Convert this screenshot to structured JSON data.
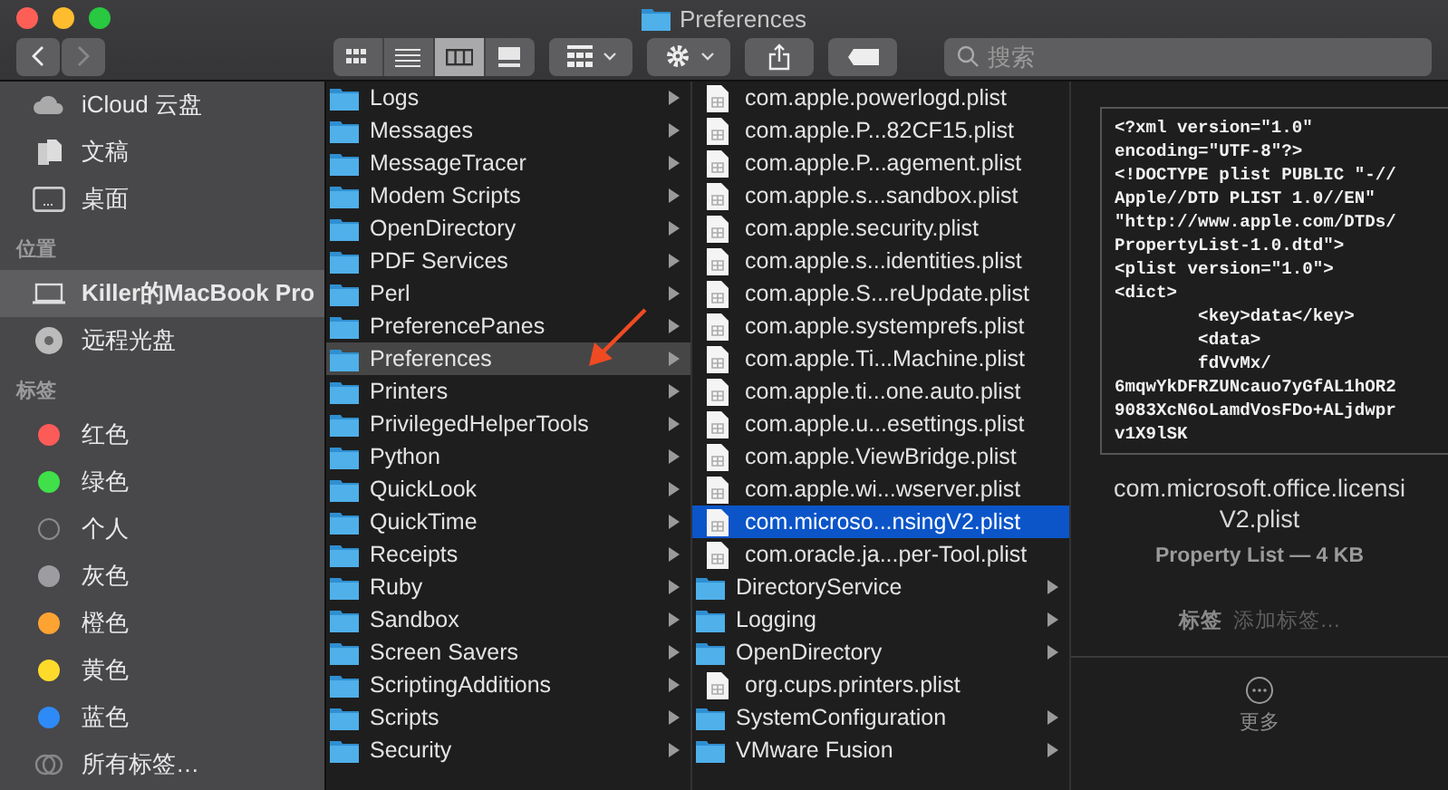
{
  "window": {
    "title": "Preferences"
  },
  "toolbar": {
    "back_disabled": false,
    "forward_disabled": true,
    "view_modes": [
      {
        "kind": "icons",
        "selected": false
      },
      {
        "kind": "list",
        "selected": false
      },
      {
        "kind": "columns",
        "selected": true
      },
      {
        "kind": "gallery",
        "selected": false
      }
    ],
    "search": {
      "placeholder": "搜索"
    }
  },
  "sidebar": [
    {
      "kind": "cloud",
      "label": "iCloud 云盘",
      "selected": false
    },
    {
      "kind": "docs",
      "label": "文稿",
      "selected": false
    },
    {
      "kind": "desktop",
      "label": "桌面",
      "selected": false
    },
    {
      "kind": "header",
      "label": "位置"
    },
    {
      "kind": "laptop",
      "label": "Killer的MacBook Pro",
      "selected": true
    },
    {
      "kind": "disc",
      "label": "远程光盘",
      "selected": false
    },
    {
      "kind": "header",
      "label": "标签"
    },
    {
      "kind": "tag",
      "label": "红色",
      "color": "#fc5b57"
    },
    {
      "kind": "tag",
      "label": "绿色",
      "color": "#3fe04a"
    },
    {
      "kind": "tag",
      "label": "个人"
    },
    {
      "kind": "tag",
      "label": "灰色",
      "color": "#9d9da1"
    },
    {
      "kind": "tag",
      "label": "橙色",
      "color": "#fda332"
    },
    {
      "kind": "tag",
      "label": "黄色",
      "color": "#fedb2b"
    },
    {
      "kind": "tag",
      "label": "蓝色",
      "color": "#2e8af7"
    },
    {
      "kind": "alltags",
      "label": "所有标签…",
      "selected": false
    }
  ],
  "columns": [
    [
      {
        "kind": "folder",
        "name": "Logs",
        "selected": false
      },
      {
        "kind": "folder",
        "name": "Messages",
        "selected": false
      },
      {
        "kind": "folder",
        "name": "MessageTracer",
        "selected": false
      },
      {
        "kind": "folder",
        "name": "Modem Scripts",
        "selected": false
      },
      {
        "kind": "folder",
        "name": "OpenDirectory",
        "selected": false
      },
      {
        "kind": "folder",
        "name": "PDF Services",
        "selected": false
      },
      {
        "kind": "folder",
        "name": "Perl",
        "selected": false
      },
      {
        "kind": "folder",
        "name": "PreferencePanes",
        "selected": false
      },
      {
        "kind": "folder",
        "name": "Preferences",
        "selected": true
      },
      {
        "kind": "folder",
        "name": "Printers",
        "selected": false
      },
      {
        "kind": "folder",
        "name": "PrivilegedHelperTools",
        "selected": false
      },
      {
        "kind": "folder",
        "name": "Python",
        "selected": false
      },
      {
        "kind": "folder",
        "name": "QuickLook",
        "selected": false
      },
      {
        "kind": "folder",
        "name": "QuickTime",
        "selected": false
      },
      {
        "kind": "folder",
        "name": "Receipts",
        "selected": false
      },
      {
        "kind": "folder",
        "name": "Ruby",
        "selected": false
      },
      {
        "kind": "folder",
        "name": "Sandbox",
        "selected": false
      },
      {
        "kind": "folder",
        "name": "Screen Savers",
        "selected": false
      },
      {
        "kind": "folder",
        "name": "ScriptingAdditions",
        "selected": false
      },
      {
        "kind": "folder",
        "name": "Scripts",
        "selected": false
      },
      {
        "kind": "folder",
        "name": "Security",
        "selected": false
      }
    ],
    [
      {
        "kind": "file",
        "name": "com.apple.powerlogd.plist",
        "selected": false
      },
      {
        "kind": "file",
        "name": "com.apple.P...82CF15.plist",
        "selected": false
      },
      {
        "kind": "file",
        "name": "com.apple.P...agement.plist",
        "selected": false
      },
      {
        "kind": "file",
        "name": "com.apple.s...sandbox.plist",
        "selected": false
      },
      {
        "kind": "file",
        "name": "com.apple.security.plist",
        "selected": false
      },
      {
        "kind": "file",
        "name": "com.apple.s...identities.plist",
        "selected": false
      },
      {
        "kind": "file",
        "name": "com.apple.S...reUpdate.plist",
        "selected": false
      },
      {
        "kind": "file",
        "name": "com.apple.systemprefs.plist",
        "selected": false
      },
      {
        "kind": "file",
        "name": "com.apple.Ti...Machine.plist",
        "selected": false
      },
      {
        "kind": "file",
        "name": "com.apple.ti...one.auto.plist",
        "selected": false
      },
      {
        "kind": "file",
        "name": "com.apple.u...esettings.plist",
        "selected": false
      },
      {
        "kind": "file",
        "name": "com.apple.ViewBridge.plist",
        "selected": false
      },
      {
        "kind": "file",
        "name": "com.apple.wi...wserver.plist",
        "selected": false
      },
      {
        "kind": "file",
        "name": "com.microso...nsingV2.plist",
        "selected": true
      },
      {
        "kind": "file",
        "name": "com.oracle.ja...per-Tool.plist",
        "selected": false
      },
      {
        "kind": "folder",
        "name": "DirectoryService",
        "selected": false
      },
      {
        "kind": "folder",
        "name": "Logging",
        "selected": false
      },
      {
        "kind": "folder",
        "name": "OpenDirectory",
        "selected": false
      },
      {
        "kind": "file",
        "name": "org.cups.printers.plist",
        "selected": false
      },
      {
        "kind": "folder",
        "name": "SystemConfiguration",
        "selected": false
      },
      {
        "kind": "folder",
        "name": "VMware Fusion",
        "selected": false
      }
    ]
  ],
  "preview": {
    "code_lines": [
      "<?xml version=\"1.0\"",
      "encoding=\"UTF-8\"?>",
      "<!DOCTYPE plist PUBLIC \"-//",
      "Apple//DTD PLIST 1.0//EN\"",
      "\"http://www.apple.com/DTDs/",
      "PropertyList-1.0.dtd\">",
      "<plist version=\"1.0\">",
      "<dict>",
      "        <key>data</key>",
      "        <data>",
      "        fdVvMx/",
      "6mqwYkDFRZUNcauo7yGfAL1hOR2",
      "9083XcN6oLamdVosFDo+ALjdwpr",
      "v1X9lSK"
    ],
    "name_lines": [
      "com.microsoft.office.licensi",
      "V2.plist"
    ],
    "info": "Property List — 4 KB",
    "tags_label": "标签",
    "tags_placeholder": "添加标签…",
    "more": "更多"
  }
}
